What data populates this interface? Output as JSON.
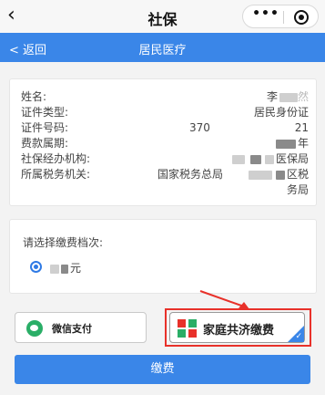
{
  "topbar": {
    "back_icon": "‹",
    "title": "社保",
    "more_icon": "•••"
  },
  "subbar": {
    "back_label": "< 返回",
    "title": "居民医疗"
  },
  "info": {
    "rows": [
      {
        "key": "姓名:",
        "value": "李"
      },
      {
        "key": "证件类型:",
        "value": "居民身份证"
      },
      {
        "key": "证件号码:",
        "value_prefix": "370",
        "value_suffix": "21"
      },
      {
        "key": "费款属期:",
        "value": "年"
      },
      {
        "key": "社保经办机构:",
        "value": "医保局"
      },
      {
        "key": "所属税务机关:",
        "value_prefix": "国家税务总局",
        "value_suffix": "区税",
        "value_line2": "务局"
      }
    ]
  },
  "tier": {
    "label": "请选择缴费档次:",
    "option_suffix": "元"
  },
  "payment": {
    "wechat_label": "微信支付",
    "family_label": "家庭共济缴费",
    "selected_check": "✓"
  },
  "submit_label": "缴费",
  "colors": {
    "primary": "#3a86e8",
    "annotation": "#e8312a",
    "wechat": "#2aae67"
  }
}
